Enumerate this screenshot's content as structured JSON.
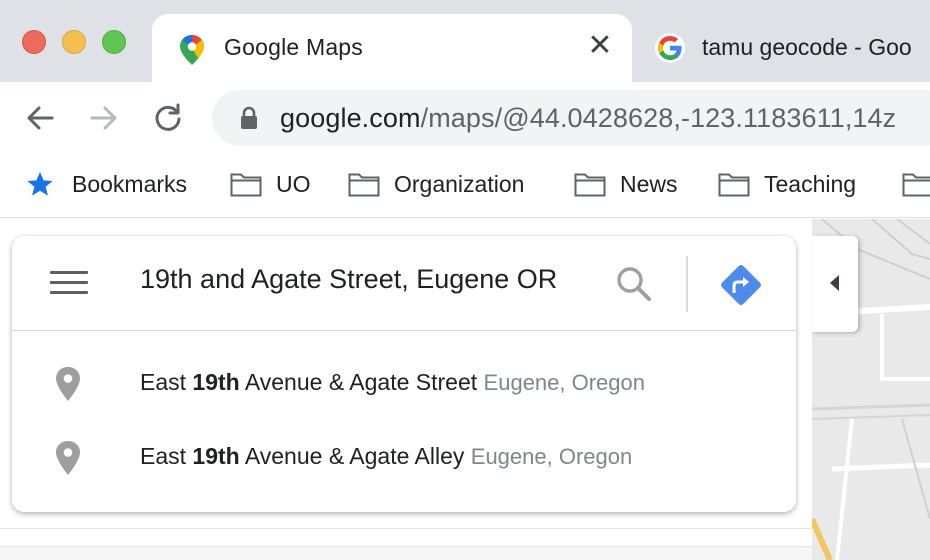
{
  "window": {
    "traffic_lights": [
      "close",
      "minimize",
      "maximize"
    ]
  },
  "tabs": [
    {
      "title": "Google Maps",
      "active": true,
      "icon": "google-maps-icon"
    },
    {
      "title": "tamu geocode - Goo",
      "active": false,
      "icon": "google-g-icon"
    }
  ],
  "toolbar": {
    "url_host": "google.com",
    "url_path": "/maps/@44.0428628,-123.1183611,14z"
  },
  "bookmarks": [
    {
      "label": "Bookmarks",
      "icon": "star-icon"
    },
    {
      "label": "UO",
      "icon": "folder-icon"
    },
    {
      "label": "Organization",
      "icon": "folder-icon"
    },
    {
      "label": "News",
      "icon": "folder-icon"
    },
    {
      "label": "Teaching",
      "icon": "folder-icon"
    },
    {
      "label": "",
      "icon": "folder-icon"
    }
  ],
  "search": {
    "query": "19th and Agate Street, Eugene OR"
  },
  "suggestions": [
    {
      "pre": "East ",
      "bold": "19th",
      "post": " Avenue & Agate Street",
      "secondary": "Eugene, Oregon"
    },
    {
      "pre": "East ",
      "bold": "19th",
      "post": " Avenue & Agate Alley",
      "secondary": "Eugene, Oregon"
    }
  ],
  "colors": {
    "tabstrip": "#dee1e6",
    "accent_blue": "#4285f4",
    "direction_blue": "#4d8bea"
  }
}
